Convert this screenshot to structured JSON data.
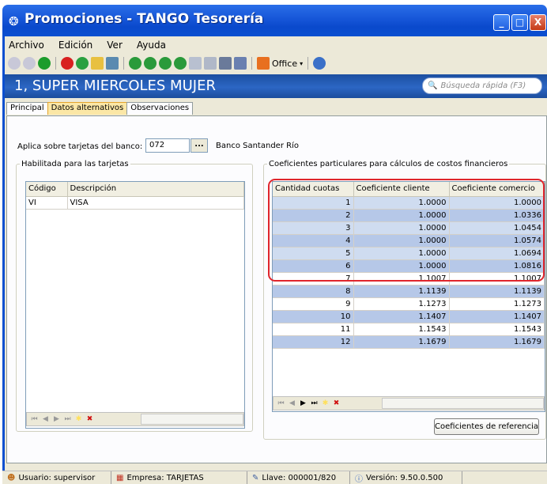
{
  "window": {
    "title": "Promociones - TANGO Tesorería",
    "controls": {
      "minimize": "_",
      "maximize": "□",
      "close": "X"
    }
  },
  "menu": [
    "Archivo",
    "Edición",
    "Ver",
    "Ayuda"
  ],
  "toolbar": {
    "office_label": "Office"
  },
  "header": {
    "title": "1, SUPER MIERCOLES MUJER",
    "search_placeholder": "Búsqueda rápida (F3)"
  },
  "tabs": [
    "Principal",
    "Datos alternativos",
    "Observaciones"
  ],
  "active_tab": "Datos alternativos",
  "bank": {
    "label": "Aplica sobre tarjetas del banco:",
    "code": "072",
    "button": "...",
    "name": "Banco Santander Río"
  },
  "cards": {
    "legend": "Habilitada para las tarjetas",
    "columns": [
      "Código",
      "Descripción"
    ],
    "rows": [
      [
        "VI",
        "VISA"
      ]
    ]
  },
  "coef": {
    "legend": "Coeficientes particulares para cálculos de costos financieros",
    "columns": [
      "Cantidad cuotas",
      "Coeficiente cliente",
      "Coeficiente comercio"
    ],
    "rows": [
      [
        "1",
        "1.0000",
        "1.0000"
      ],
      [
        "2",
        "1.0000",
        "1.0336"
      ],
      [
        "3",
        "1.0000",
        "1.0454"
      ],
      [
        "4",
        "1.0000",
        "1.0574"
      ],
      [
        "5",
        "1.0000",
        "1.0694"
      ],
      [
        "6",
        "1.0000",
        "1.0816"
      ],
      [
        "7",
        "1.1007",
        "1.1007"
      ],
      [
        "8",
        "1.1139",
        "1.1139"
      ],
      [
        "9",
        "1.1273",
        "1.1273"
      ],
      [
        "10",
        "1.1407",
        "1.1407"
      ],
      [
        "11",
        "1.1543",
        "1.1543"
      ],
      [
        "12",
        "1.1679",
        "1.1679"
      ]
    ],
    "ref_button": "Coeficientes de referencia"
  },
  "status": {
    "user": "Usuario: supervisor",
    "company": "Empresa: TARJETAS",
    "key": "Llave: 000001/820",
    "version": "Versión: 9.50.0.500"
  }
}
